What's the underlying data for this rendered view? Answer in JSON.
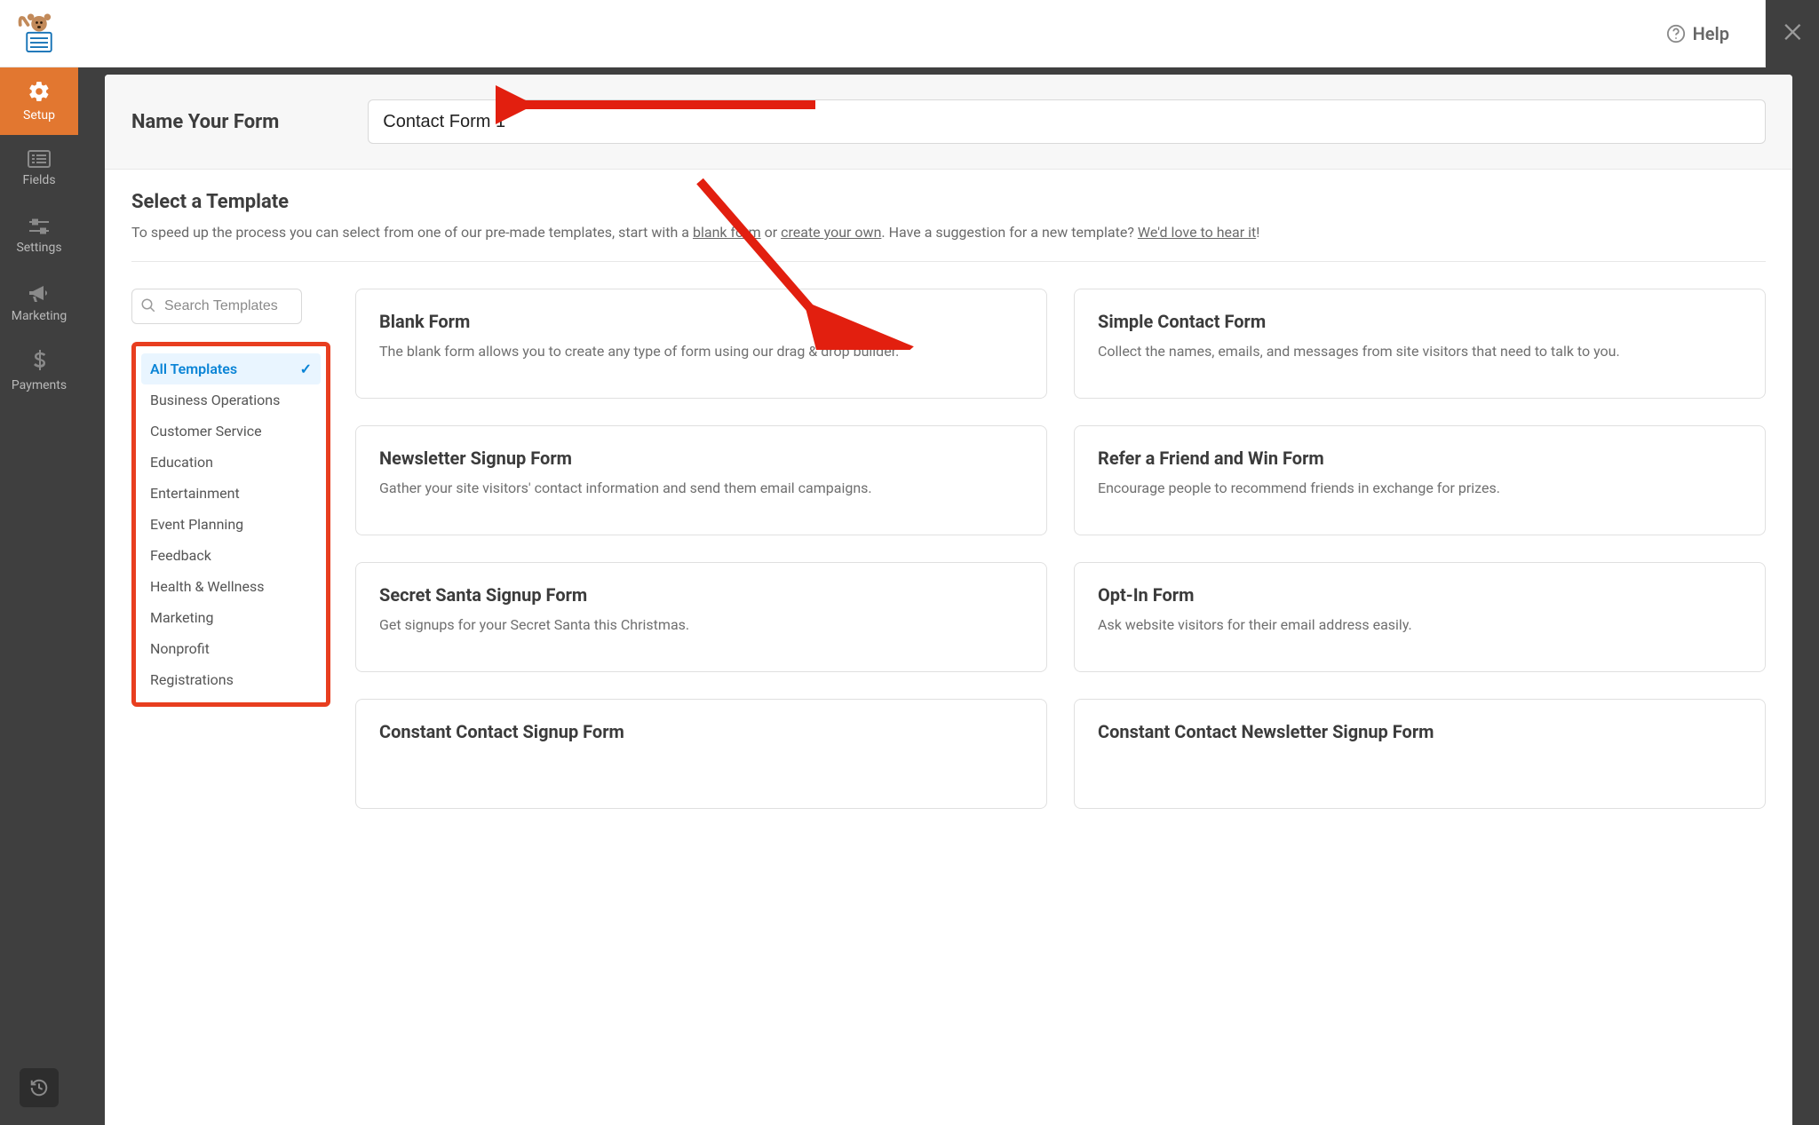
{
  "header": {
    "help_label": "Help"
  },
  "sidebar": {
    "items": [
      {
        "label": "Setup"
      },
      {
        "label": "Fields"
      },
      {
        "label": "Settings"
      },
      {
        "label": "Marketing"
      },
      {
        "label": "Payments"
      }
    ]
  },
  "name_section": {
    "label": "Name Your Form",
    "value": "Contact Form 1"
  },
  "select_section": {
    "title": "Select a Template",
    "desc_parts": {
      "p1": "To speed up the process you can select from one of our pre-made templates, start with a ",
      "link1": "blank form",
      "p2": " or ",
      "link2": "create your own",
      "p3": ". Have a suggestion for a new template? ",
      "link3": "We'd love to hear it",
      "p4": "!"
    }
  },
  "search": {
    "placeholder": "Search Templates"
  },
  "categories": [
    {
      "label": "All Templates",
      "active": true
    },
    {
      "label": "Business Operations"
    },
    {
      "label": "Customer Service"
    },
    {
      "label": "Education"
    },
    {
      "label": "Entertainment"
    },
    {
      "label": "Event Planning"
    },
    {
      "label": "Feedback"
    },
    {
      "label": "Health & Wellness"
    },
    {
      "label": "Marketing"
    },
    {
      "label": "Nonprofit"
    },
    {
      "label": "Registrations"
    }
  ],
  "templates": [
    {
      "title": "Blank Form",
      "desc": "The blank form allows you to create any type of form using our drag & drop builder."
    },
    {
      "title": "Simple Contact Form",
      "desc": "Collect the names, emails, and messages from site visitors that need to talk to you."
    },
    {
      "title": "Newsletter Signup Form",
      "desc": "Gather your site visitors' contact information and send them email campaigns."
    },
    {
      "title": "Refer a Friend and Win Form",
      "desc": "Encourage people to recommend friends in exchange for prizes."
    },
    {
      "title": "Secret Santa Signup Form",
      "desc": "Get signups for your Secret Santa this Christmas."
    },
    {
      "title": "Opt-In Form",
      "desc": "Ask website visitors for their email address easily."
    },
    {
      "title": "Constant Contact Signup Form",
      "desc": ""
    },
    {
      "title": "Constant Contact Newsletter Signup Form",
      "desc": ""
    }
  ]
}
